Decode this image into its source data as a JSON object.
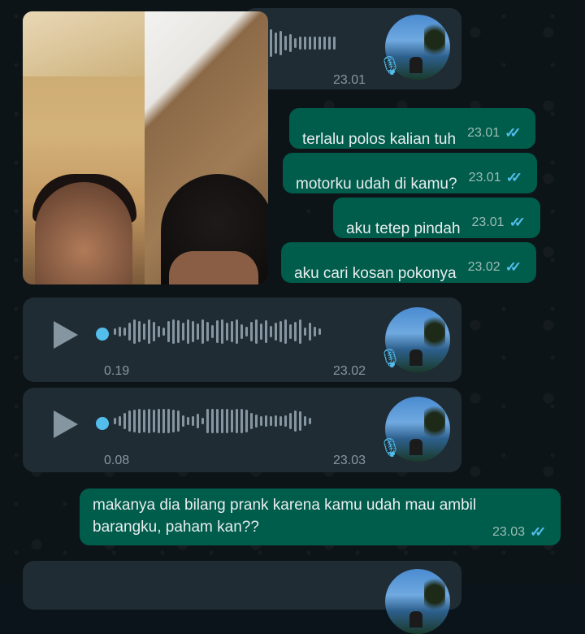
{
  "messages": {
    "video": {
      "label": "video-message"
    },
    "voice_top": {
      "time": "23.01"
    },
    "out1": {
      "text": "terlalu polos kalian tuh",
      "time": "23.01"
    },
    "out2": {
      "text": "motorku udah di kamu?",
      "time": "23.01"
    },
    "out3": {
      "text": "aku tetep pindah",
      "time": "23.01"
    },
    "out4": {
      "text": "aku cari kosan pokonya",
      "time": "23.02"
    },
    "voice1": {
      "duration": "0.19",
      "time": "23.02"
    },
    "voice2": {
      "duration": "0.08",
      "time": "23.03"
    },
    "out5": {
      "line1": "makanya dia bilang prank karena kamu udah mau ambil",
      "line2": "barangku, paham kan??",
      "time": "23.03"
    }
  },
  "icons": {
    "play": "play-icon",
    "mic": "microphone-icon",
    "read": "double-check-icon"
  },
  "colors": {
    "outgoing_bubble": "#005c4b",
    "incoming_bubble": "#1f2c34",
    "read_ticks": "#53bdeb"
  }
}
